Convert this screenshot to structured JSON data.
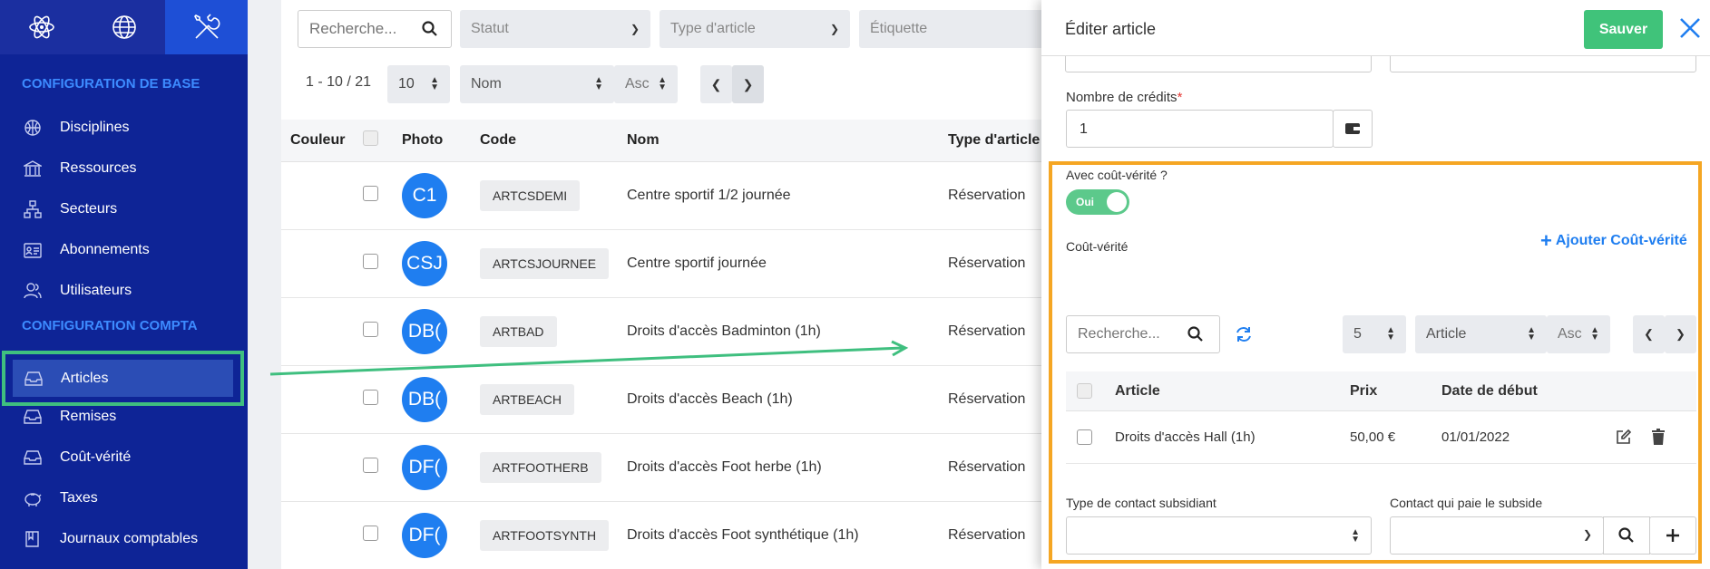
{
  "sidebar": {
    "section_base": "Configuration de base",
    "section_compta": "Configuration compta",
    "items": [
      {
        "label": "Disciplines"
      },
      {
        "label": "Ressources"
      },
      {
        "label": "Secteurs"
      },
      {
        "label": "Abonnements"
      },
      {
        "label": "Utilisateurs"
      },
      {
        "label": "Articles"
      },
      {
        "label": "Remises"
      },
      {
        "label": "Coût-vérité"
      },
      {
        "label": "Taxes"
      },
      {
        "label": "Journaux comptables"
      }
    ]
  },
  "filters": {
    "search_placeholder": "Recherche...",
    "statut": "Statut",
    "type": "Type d'article",
    "etiquette": "Étiquette",
    "range": "1 - 10 / 21",
    "per_page": "10",
    "sort_field": "Nom",
    "sort_dir": "Asc"
  },
  "table": {
    "headers": {
      "couleur": "Couleur",
      "photo": "Photo",
      "code": "Code",
      "nom": "Nom",
      "type": "Type d'article"
    },
    "rows": [
      {
        "initials": "C1",
        "code": "ARTCSDEMI",
        "nom": "Centre sportif 1/2 journée",
        "type": "Réservation"
      },
      {
        "initials": "CSJ",
        "code": "ARTCSJOURNEE",
        "nom": "Centre sportif journée",
        "type": "Réservation"
      },
      {
        "initials": "DB(",
        "code": "ARTBAD",
        "nom": "Droits d'accès Badminton (1h)",
        "type": "Réservation"
      },
      {
        "initials": "DB(",
        "code": "ARTBEACH",
        "nom": "Droits d'accès Beach (1h)",
        "type": "Réservation"
      },
      {
        "initials": "DF(",
        "code": "ARTFOOTHERB",
        "nom": "Droits d'accès Foot herbe (1h)",
        "type": "Réservation"
      },
      {
        "initials": "DF(",
        "code": "ARTFOOTSYNTH",
        "nom": "Droits d'accès Foot synthétique (1h)",
        "type": "Réservation"
      }
    ]
  },
  "panel": {
    "title": "Éditer article",
    "save": "Sauver",
    "credits_label": "Nombre de crédits",
    "required_mark": "*",
    "credits_value": "1",
    "cv_question": "Avec coût-vérité ?",
    "toggle_label": "Oui",
    "cv_title": "Coût-vérité",
    "add_cv": "Ajouter Coût-vérité",
    "search_placeholder": "Recherche...",
    "per_page": "5",
    "sort_field": "Article",
    "sort_dir": "Asc",
    "headers": {
      "article": "Article",
      "prix": "Prix",
      "date": "Date de début"
    },
    "row": {
      "article": "Droits d'accès Hall (1h)",
      "prix": "50,00 €",
      "date": "01/01/2022"
    },
    "type_contact_label": "Type de contact subsidiant",
    "contact_payeur_label": "Contact qui paie le subside"
  },
  "colors": {
    "sidebar": "#0e2496",
    "accent": "#1f7ef0",
    "save": "#40c37a",
    "highlight_green": "#3fbf7f",
    "highlight_orange": "#f5a623"
  }
}
